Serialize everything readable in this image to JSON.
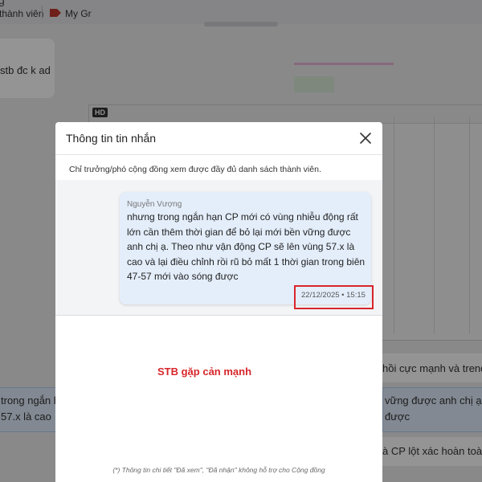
{
  "background": {
    "header_partial_letter": "g",
    "members_label": "thành viên",
    "group_label": "My Gr",
    "top_bubble_text": "stb đc k ad",
    "image_badge": "HD",
    "row1_text": "hồi cực mạnh và trend",
    "left_bubble_line1": "trong ngắn h",
    "left_bubble_line2": "57.x là cao",
    "right_bubble_line1": "vững được anh chị ạ. T",
    "right_bubble_line2": "được",
    "row3_text": "à CP lột xác hoàn toàn"
  },
  "modal": {
    "title": "Thông tin tin nhắn",
    "notice": "Chỉ trưởng/phó cộng đồng xem được đầy đủ danh sách thành viên.",
    "message": {
      "sender": "Nguyễn Vượng",
      "text": "nhưng trong ngắn hạn CP mới có vùng nhiễu động rất lớn cần thêm thời gian để bỏ lại mới bền vững được anh chị ạ. Theo như vận động CP sẽ lên vùng 57.x là cao và lại điều chỉnh rồi rũ bỏ mất 1 thời gian trong biên 47-57 mới vào sóng được",
      "time": "22/12/2025 • 15:15"
    },
    "footnote": "(*) Thông tin chi tiết \"Đã xem\", \"Đã nhận\" không hỗ trợ cho Cộng đồng"
  },
  "annotation": "STB gặp cản mạnh",
  "colors": {
    "highlight_red": "#d7262b",
    "bubble_blue": "#e4eefb"
  }
}
